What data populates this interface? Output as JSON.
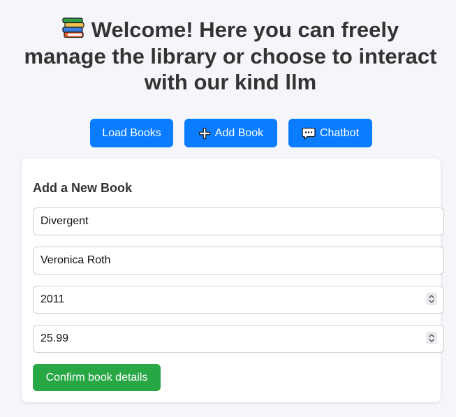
{
  "header": {
    "title": "Welcome! Here you can freely manage the library or choose to interact with our kind llm",
    "icon": "books-icon"
  },
  "toolbar": {
    "load_label": "Load Books",
    "add_label": "Add Book",
    "add_icon": "plus-icon",
    "chat_label": "Chatbot",
    "chat_icon": "speech-bubble-icon"
  },
  "form": {
    "heading": "Add a New Book",
    "title_value": "Divergent",
    "author_value": "Veronica Roth",
    "year_value": "2011",
    "price_value": "25.99",
    "confirm_label": "Confirm book details"
  },
  "colors": {
    "background": "#f5f6fa",
    "primary_button": "#0a7cff",
    "confirm_button": "#28a745",
    "card": "#ffffff",
    "text": "#333333"
  }
}
